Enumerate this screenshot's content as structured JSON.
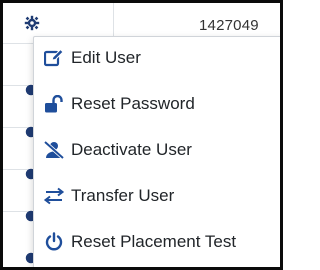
{
  "table": {
    "visible_id": "1427049"
  },
  "menu": {
    "items": [
      {
        "label": "Edit User",
        "icon": "edit-icon"
      },
      {
        "label": "Reset Password",
        "icon": "lock-open-icon"
      },
      {
        "label": "Deactivate User",
        "icon": "user-slash-icon"
      },
      {
        "label": "Transfer User",
        "icon": "transfer-arrows-icon"
      },
      {
        "label": "Reset Placement Test",
        "icon": "power-icon"
      }
    ]
  },
  "colors": {
    "icon": "#1f4e9b",
    "text": "#212529",
    "gear": "#1f3b73",
    "border": "#0a0a0a"
  }
}
